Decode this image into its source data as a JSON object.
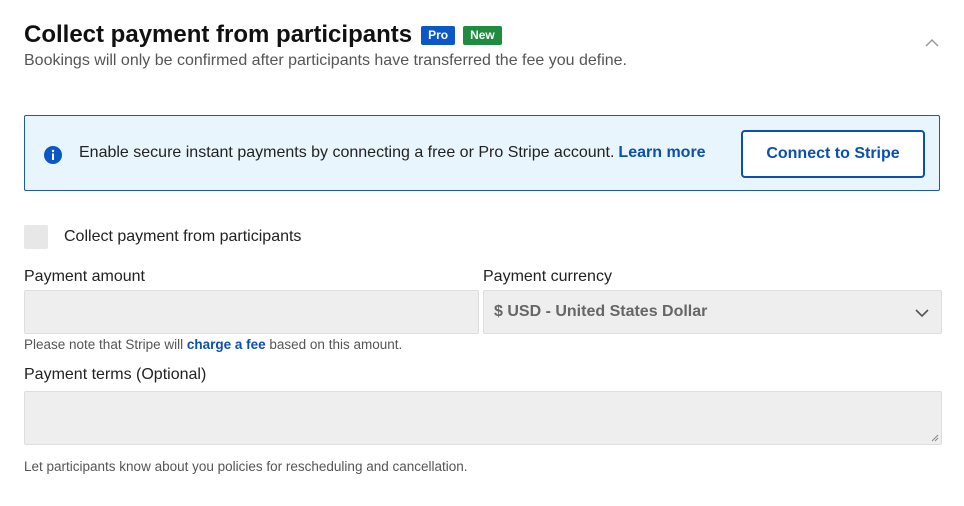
{
  "header": {
    "title": "Collect payment from participants",
    "badge_pro": "Pro",
    "badge_new": "New",
    "subtitle": "Bookings will only be confirmed after participants have transferred the fee you define."
  },
  "info_box": {
    "text": "Enable secure instant payments by connecting a free or Pro Stripe account.",
    "learn_more": "Learn more",
    "connect_button": "Connect to Stripe"
  },
  "checkbox": {
    "label": "Collect payment from participants",
    "checked": false
  },
  "payment_amount": {
    "label": "Payment amount",
    "value": ""
  },
  "payment_currency": {
    "label": "Payment currency",
    "selected": "$ USD - United States Dollar"
  },
  "fee_note": {
    "prefix": "Please note that Stripe will ",
    "link": "charge a fee",
    "suffix": " based on this amount."
  },
  "payment_terms": {
    "label": "Payment terms (Optional)",
    "value": "",
    "help": "Let participants know about you policies for rescheduling and cancellation."
  },
  "colors": {
    "link": "#0b4fb0",
    "badge_pro": "#0b57c5",
    "badge_new": "#1f8c3f",
    "info_bg": "#e9f5fc",
    "field_bg": "#eeeeef"
  }
}
